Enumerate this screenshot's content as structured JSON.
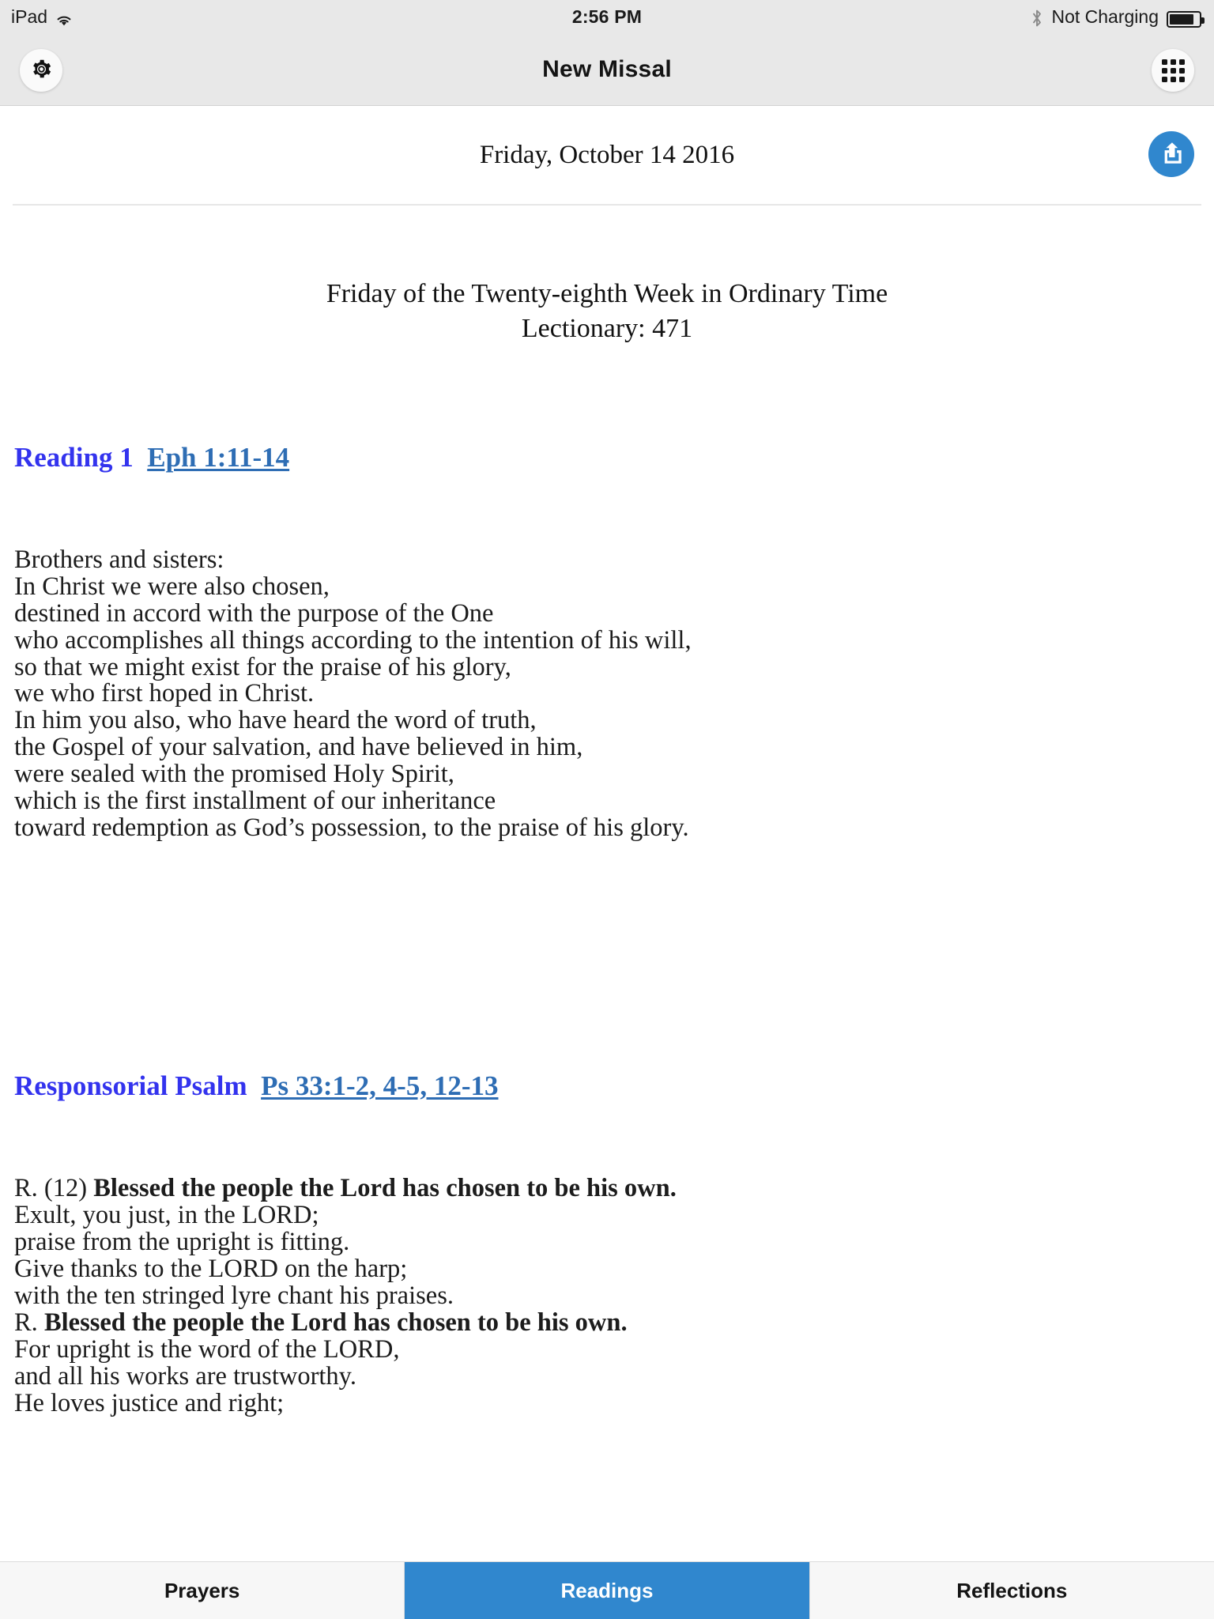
{
  "status_bar": {
    "device": "iPad",
    "wifi_icon": "wifi-icon",
    "time": "2:56 PM",
    "bluetooth_icon": "bluetooth-icon",
    "charging_status": "Not Charging",
    "battery_icon": "battery-icon",
    "battery_level_percent": 75
  },
  "nav_bar": {
    "title": "New Missal",
    "settings_icon": "gear-icon",
    "grid_icon": "grid-apps-icon"
  },
  "date_header": {
    "date": "Friday, October 14 2016",
    "share_icon": "share-export-icon"
  },
  "document": {
    "liturgy_title": "Friday of the Twenty-eighth Week in Ordinary Time",
    "lectionary": "Lectionary: 471",
    "sections": [
      {
        "label": "Reading 1",
        "reference": "Eph 1:11-14",
        "body": "Brothers and sisters:\nIn Christ we were also chosen,\ndestined in accord with the purpose of the One\nwho accomplishes all things according to the intention of his will,\nso that we might exist for the praise of his glory,\nwe who first hoped in Christ.\nIn him you also, who have heard the word of truth,\nthe Gospel of your salvation, and have believed in him,\nwere sealed with the promised Holy Spirit,\nwhich is the first installment of our inheritance\ntoward redemption as God’s possession, to the praise of his glory."
      },
      {
        "label": "Responsorial Psalm",
        "reference": "Ps 33:1-2, 4-5, 12-13",
        "refrain_prefix_1": "R. (12) ",
        "refrain_1": "Blessed the people the Lord has chosen to be his own.",
        "verse_1": "Exult, you just, in the LORD;\npraise from the upright is fitting.\nGive thanks to the LORD on the harp;\nwith the ten stringed lyre chant his praises.",
        "refrain_prefix_2": "R. ",
        "refrain_2": "Blessed the people the Lord has chosen to be his own.",
        "verse_2": "For upright is the word of the LORD,\nand all his works are trustworthy.\nHe loves justice and right;"
      }
    ]
  },
  "tab_bar": {
    "tabs": [
      {
        "label": "Prayers",
        "active": false
      },
      {
        "label": "Readings",
        "active": true
      },
      {
        "label": "Reflections",
        "active": false
      }
    ]
  },
  "colors": {
    "accent_blue": "#3087ce",
    "heading_blue": "#3333ee",
    "link_blue": "#2e6db4",
    "chrome_gray": "#e8e8e8",
    "tab_bar_gray": "#f7f7f7"
  }
}
